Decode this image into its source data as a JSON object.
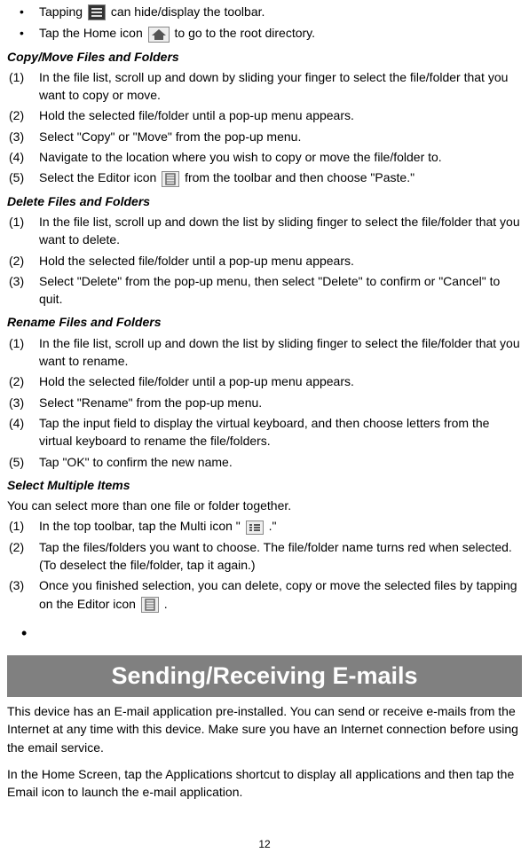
{
  "bullets": {
    "b1_a": "Tapping ",
    "b1_b": " can hide/display the toolbar.",
    "b2_a": "Tap the Home icon ",
    "b2_b": " to go to the root directory."
  },
  "copy": {
    "title": "Copy/Move Files and Folders",
    "s1": "In the file list, scroll up and down by sliding your finger to select the file/folder that you want to copy or move.",
    "s2": "Hold the selected file/folder until a pop-up menu appears.",
    "s3": "Select \"Copy\" or \"Move\" from the pop-up menu.",
    "s4": "Navigate to the location where you wish to copy or move the file/folder to.",
    "s5_a": "Select the Editor icon ",
    "s5_b": "from the toolbar and then choose \"Paste.\""
  },
  "delete": {
    "title": "Delete Files and Folders",
    "s1": "In the file list, scroll up and down the list by sliding finger to select the file/folder that you want to delete.",
    "s2": "Hold the selected file/folder until a pop-up menu appears.",
    "s3": "Select \"Delete\" from the pop-up menu, then select \"Delete\" to confirm or \"Cancel\" to quit."
  },
  "rename": {
    "title": "Rename Files and Folders",
    "s1": "In the file list, scroll up and down the list by sliding finger to select the file/folder that you want to rename.",
    "s2": "Hold the selected file/folder until a pop-up menu appears.",
    "s3": "Select \"Rename\" from the pop-up menu.",
    "s4": "Tap the input field to display the virtual keyboard, and then choose letters from the virtual keyboard to rename the file/folders.",
    "s5": "Tap \"OK\" to confirm the new name."
  },
  "multi": {
    "title": "Select Multiple Items",
    "intro": "You can select more than one file or folder together.",
    "s1_a": "In the top toolbar, tap the Multi icon \"",
    "s1_b": ".\"",
    "s2": "Tap the files/folders you want to choose. The file/folder name turns red when selected. (To deselect the file/folder, tap it again.)",
    "s3_a": "Once you finished selection, you can delete, copy or move the selected files by tapping on the Editor icon",
    "s3_b": "."
  },
  "email": {
    "heading": "Sending/Receiving E-mails",
    "p1": "This device has an E-mail application pre-installed. You can send or receive e-mails from the Internet at any time with this device. Make sure you have an Internet connection before using the email service.",
    "p2": "In the Home Screen, tap the Applications shortcut to display all applications and then tap the Email icon to launch the e-mail application."
  },
  "labels": {
    "n1": "(1)",
    "n2": "(2)",
    "n3": "(3)",
    "n4": "(4)",
    "n5": "(5)",
    "bullet": "•"
  },
  "page": "12"
}
